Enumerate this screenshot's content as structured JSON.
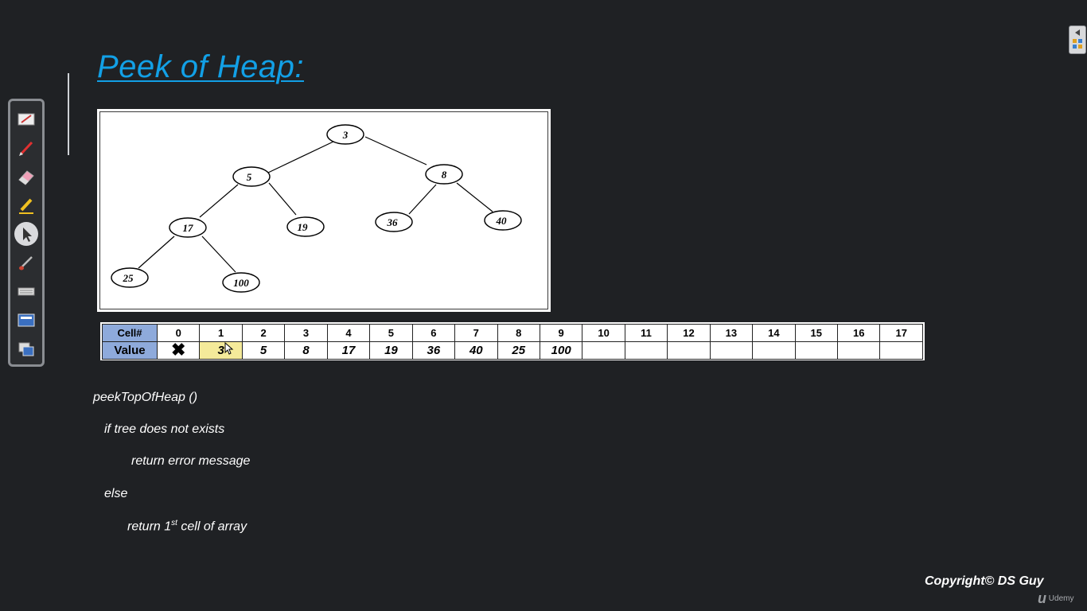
{
  "slide": {
    "title": "Peek of Heap:"
  },
  "tree": {
    "nodes": [
      "3",
      "5",
      "8",
      "17",
      "19",
      "36",
      "40",
      "25",
      "100"
    ]
  },
  "heap_table": {
    "row_headers": [
      "Cell#",
      "Value"
    ],
    "cells": [
      "0",
      "1",
      "2",
      "3",
      "4",
      "5",
      "6",
      "7",
      "8",
      "9",
      "10",
      "11",
      "12",
      "13",
      "14",
      "15",
      "16",
      "17"
    ],
    "values": [
      "✖",
      "3",
      "5",
      "8",
      "17",
      "19",
      "36",
      "40",
      "25",
      "100",
      "",
      "",
      "",
      "",
      "",
      "",
      "",
      ""
    ],
    "highlight_color": "#f4ea9a",
    "header_color": "#8eaadb"
  },
  "pseudocode": {
    "line1": "peekTopOfHeap ()",
    "line2": "if tree does not exists",
    "line3": "return error message",
    "line4": "else",
    "line5_pre": "return 1",
    "line5_sup": "st",
    "line5_post": " cell of array"
  },
  "footer": {
    "copyright": "Copyright© DS Guy",
    "brand": "Udemy"
  },
  "toolbar": {
    "tools": [
      "whiteboard-icon",
      "pen-icon",
      "eraser-icon",
      "highlighter-icon",
      "pointer-icon",
      "brush-icon",
      "keyboard-icon",
      "screen-icon",
      "capture-icon"
    ]
  },
  "colors": {
    "background": "#1f2124",
    "title": "#12a0e6"
  }
}
